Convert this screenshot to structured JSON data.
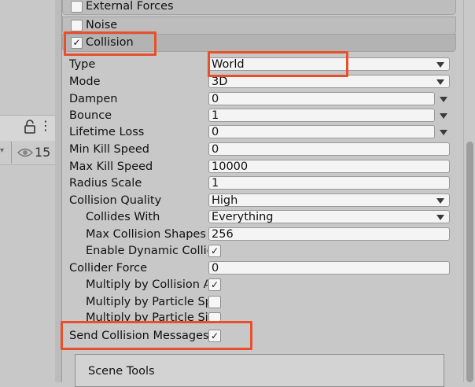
{
  "hierarchy": {
    "visible_count": "15",
    "icons": [
      "lock-icon",
      "more-icon",
      "eye-icon"
    ]
  },
  "modules": {
    "external_forces": {
      "label": "External Forces",
      "enabled": false
    },
    "noise": {
      "label": "Noise",
      "enabled": false
    },
    "collision": {
      "label": "Collision",
      "enabled": true,
      "check_glyph": "✓"
    }
  },
  "collision_props": [
    {
      "label": "Type",
      "value": "World",
      "kind": "dropdown"
    },
    {
      "label": "Mode",
      "value": "3D",
      "kind": "dropdown"
    },
    {
      "label": "Dampen",
      "value": "0",
      "kind": "curve"
    },
    {
      "label": "Bounce",
      "value": "1",
      "kind": "curve"
    },
    {
      "label": "Lifetime Loss",
      "value": "0",
      "kind": "curve"
    },
    {
      "label": "Min Kill Speed",
      "value": "0",
      "kind": "number"
    },
    {
      "label": "Max Kill Speed",
      "value": "10000",
      "kind": "number"
    },
    {
      "label": "Radius Scale",
      "value": "1",
      "kind": "number"
    },
    {
      "label": "Collision Quality",
      "value": "High",
      "kind": "dropdown"
    },
    {
      "label": "Collides With",
      "value": "Everything",
      "kind": "dropdown"
    },
    {
      "label": "Max Collision Shapes",
      "value": "256",
      "kind": "number"
    },
    {
      "label": "Enable Dynamic Collide",
      "checked": true,
      "kind": "checkbox"
    },
    {
      "label": "Collider Force",
      "value": "0",
      "kind": "number"
    },
    {
      "label": "Multiply by Collision Ar",
      "checked": true,
      "kind": "checkbox"
    },
    {
      "label": "Multiply by Particle Sp",
      "checked": false,
      "kind": "checkbox"
    },
    {
      "label": "Multiply by Particle Siz",
      "checked": false,
      "kind": "checkbox"
    },
    {
      "label": "Send Collision Messages",
      "checked": true,
      "kind": "checkbox"
    }
  ],
  "check_glyph": "✓",
  "scene_tools": {
    "title": "Scene Tools"
  },
  "colors": {
    "highlight": "#e8502d",
    "panel": "#c8c8c8",
    "field": "#f4f4f4"
  }
}
